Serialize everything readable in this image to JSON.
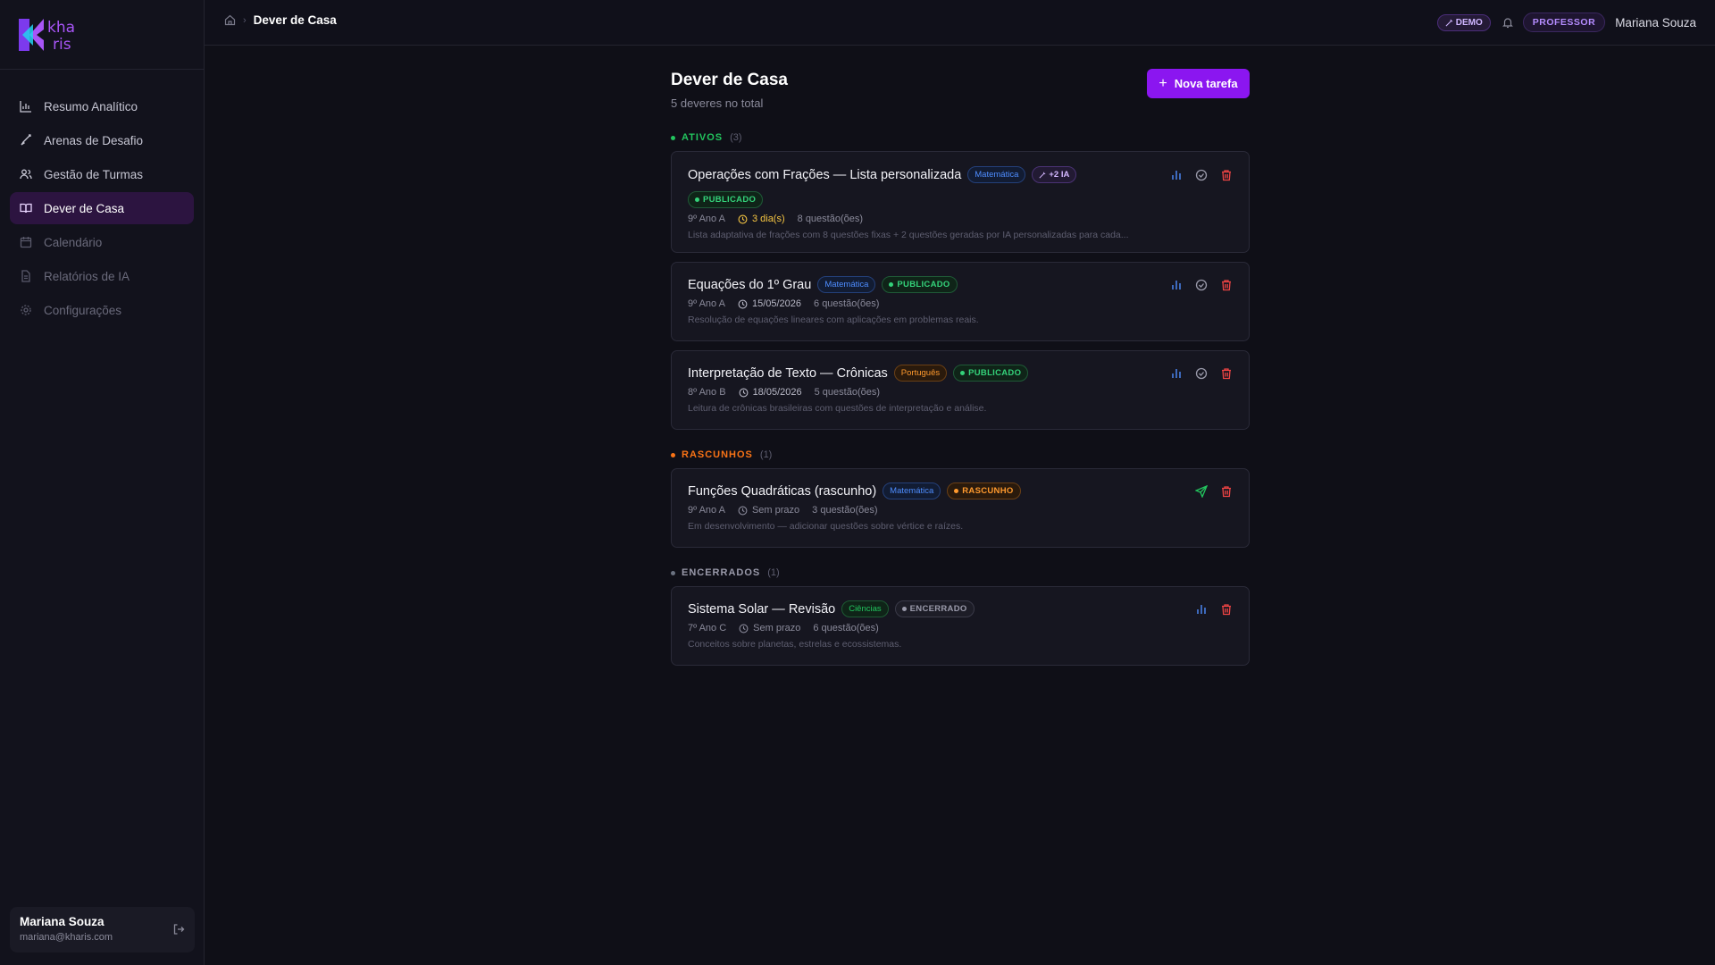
{
  "brand": {
    "logo_text_line1": "kha",
    "logo_text_line2": "ris"
  },
  "sidebar": {
    "items": [
      {
        "label": "Resumo Analítico",
        "icon": "bar-chart-icon"
      },
      {
        "label": "Arenas de Desafio",
        "icon": "sword-icon"
      },
      {
        "label": "Gestão de Turmas",
        "icon": "users-icon"
      },
      {
        "label": "Dever de Casa",
        "icon": "book-icon"
      },
      {
        "label": "Calendário",
        "icon": "calendar-icon"
      },
      {
        "label": "Relatórios de IA",
        "icon": "file-icon"
      },
      {
        "label": "Configurações",
        "icon": "gear-icon"
      }
    ],
    "user": {
      "name": "Mariana Souza",
      "email": "mariana@kharis.com"
    }
  },
  "topbar": {
    "breadcrumb_current": "Dever de Casa",
    "demo_label": "DEMO",
    "role_label": "PROFESSOR",
    "user_name": "Mariana Souza"
  },
  "page": {
    "title": "Dever de Casa",
    "subtitle": "5 deveres no total",
    "new_button": "Nova tarefa"
  },
  "colors": {
    "accent": "#8b16f0",
    "active": "#22c55e",
    "draft": "#f97316",
    "closed": "#6b7280",
    "danger": "#ef4444",
    "chart": "#3b82f6"
  },
  "sections": {
    "ativos": {
      "label": "ATIVOS",
      "count": "(3)",
      "cards": [
        {
          "title": "Operações com Frações — Lista personalizada",
          "subject": "Matemática",
          "ia": "+2 IA",
          "status": "PUBLICADO",
          "class": "9º Ano A",
          "due": "3 dia(s)",
          "questions": "8 questão(ões)",
          "desc": "Lista adaptativa de frações com 8 questões fixas + 2 questões geradas por IA personalizadas para cada..."
        },
        {
          "title": "Equações do 1º Grau",
          "subject": "Matemática",
          "status": "PUBLICADO",
          "class": "9º Ano A",
          "due": "15/05/2026",
          "questions": "6 questão(ões)",
          "desc": "Resolução de equações lineares com aplicações em problemas reais."
        },
        {
          "title": "Interpretação de Texto — Crônicas",
          "subject": "Português",
          "status": "PUBLICADO",
          "class": "8º Ano B",
          "due": "18/05/2026",
          "questions": "5 questão(ões)",
          "desc": "Leitura de crônicas brasileiras com questões de interpretação e análise."
        }
      ]
    },
    "rascunhos": {
      "label": "RASCUNHOS",
      "count": "(1)",
      "cards": [
        {
          "title": "Funções Quadráticas (rascunho)",
          "subject": "Matemática",
          "status": "RASCUNHO",
          "class": "9º Ano A",
          "due": "Sem prazo",
          "questions": "3 questão(ões)",
          "desc": "Em desenvolvimento — adicionar questões sobre vértice e raízes."
        }
      ]
    },
    "encerrados": {
      "label": "ENCERRADOS",
      "count": "(1)",
      "cards": [
        {
          "title": "Sistema Solar — Revisão",
          "subject": "Ciências",
          "status": "ENCERRADO",
          "class": "7º Ano C",
          "due": "Sem prazo",
          "questions": "6 questão(ões)",
          "desc": "Conceitos sobre planetas, estrelas e ecossistemas."
        }
      ]
    }
  }
}
